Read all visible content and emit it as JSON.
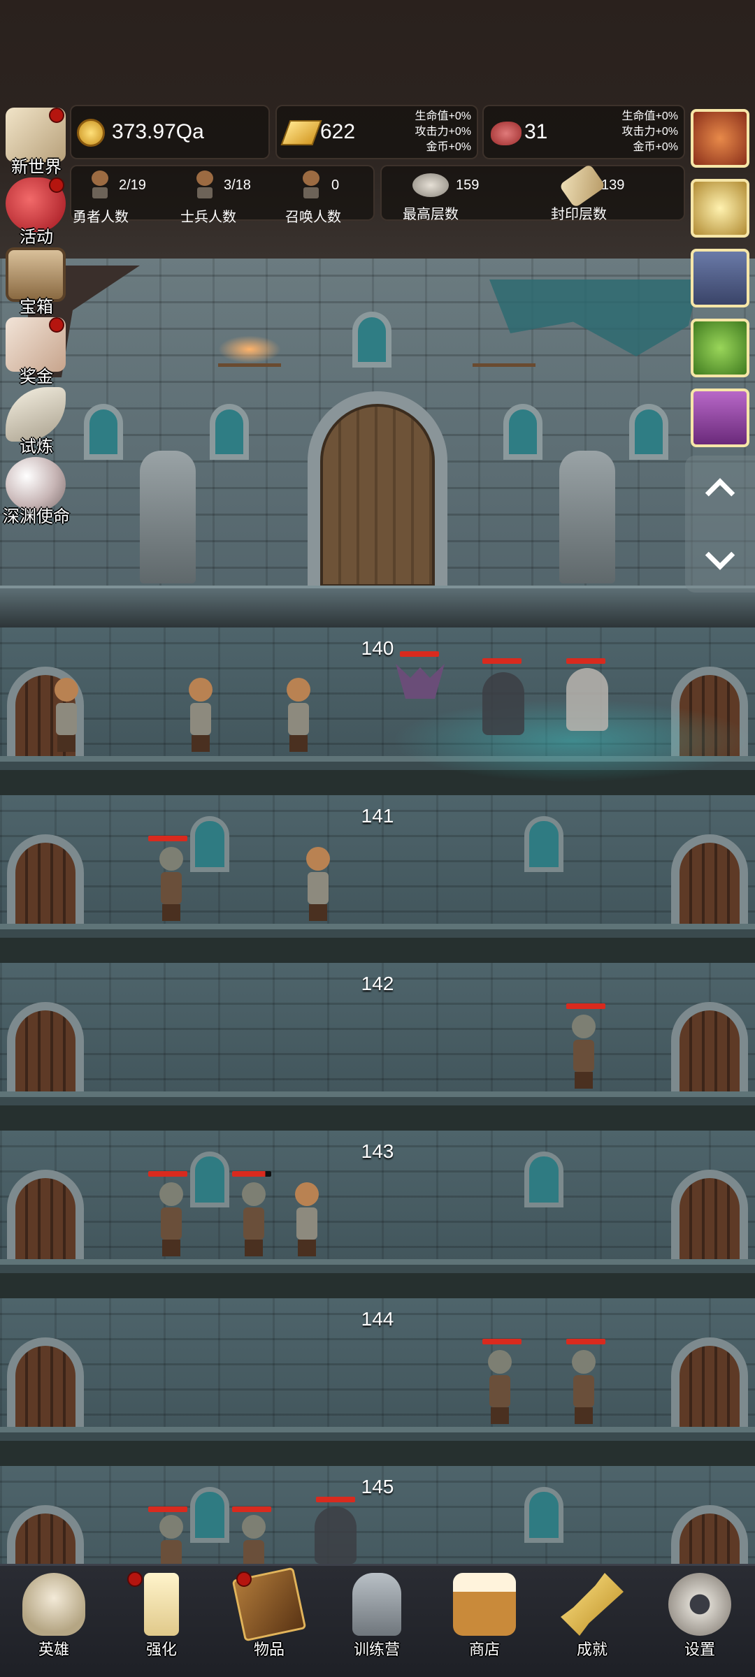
{
  "resources": {
    "coins": "373.97Qa",
    "gold": "622",
    "gold_bonus": [
      "生命值+0%",
      "攻击力+0%",
      "金币+0%"
    ],
    "meat": "31",
    "meat_bonus": [
      "生命值+0%",
      "攻击力+0%",
      "金币+0%"
    ]
  },
  "counts": {
    "heroes_value": "2/19",
    "heroes_label": "勇者人数",
    "soldiers_value": "3/18",
    "soldiers_label": "士兵人数",
    "summons_value": "0",
    "summons_label": "召唤人数",
    "max_floor_value": "159",
    "max_floor_label": "最高层数",
    "sealed_floor_value": "139",
    "sealed_floor_label": "封印层数"
  },
  "left_menu": [
    {
      "label": "新世界",
      "icon": "map-icon",
      "badge": true
    },
    {
      "label": "活动",
      "icon": "heart-icon",
      "badge": true
    },
    {
      "label": "宝箱",
      "icon": "chest-icon",
      "badge": false
    },
    {
      "label": "奖金",
      "icon": "envelope-icon",
      "badge": true
    },
    {
      "label": "试炼",
      "icon": "feather-icon",
      "badge": false
    },
    {
      "label": "深渊使命",
      "icon": "pearl-icon",
      "badge": false
    }
  ],
  "right_menu": [
    {
      "icon": "pumpkin-icon",
      "color": "#c64a2a"
    },
    {
      "icon": "candle-icon",
      "color": "#c9a64a"
    },
    {
      "icon": "backpack-icon",
      "color": "#4a5a86"
    },
    {
      "icon": "slime-icon",
      "color": "#4f9a2f"
    },
    {
      "icon": "hero-portrait-icon",
      "color": "#8a3f9a"
    }
  ],
  "floors": [
    "140",
    "141",
    "142",
    "143",
    "144",
    "145"
  ],
  "bottom_nav": [
    {
      "label": "英雄",
      "icon": "skull-icon",
      "badge": false
    },
    {
      "label": "强化",
      "icon": "candle-icon",
      "badge": true
    },
    {
      "label": "物品",
      "icon": "book-icon",
      "badge": true
    },
    {
      "label": "训练营",
      "icon": "lantern-icon",
      "badge": false
    },
    {
      "label": "商店",
      "icon": "beer-mug-icon",
      "badge": false
    },
    {
      "label": "成就",
      "icon": "key-icon",
      "badge": false
    },
    {
      "label": "设置",
      "icon": "gear-icon",
      "badge": false
    }
  ],
  "colors": {
    "accent_red": "#d92a1e",
    "badge_red": "#b5150f",
    "stone": "#4e646b"
  }
}
